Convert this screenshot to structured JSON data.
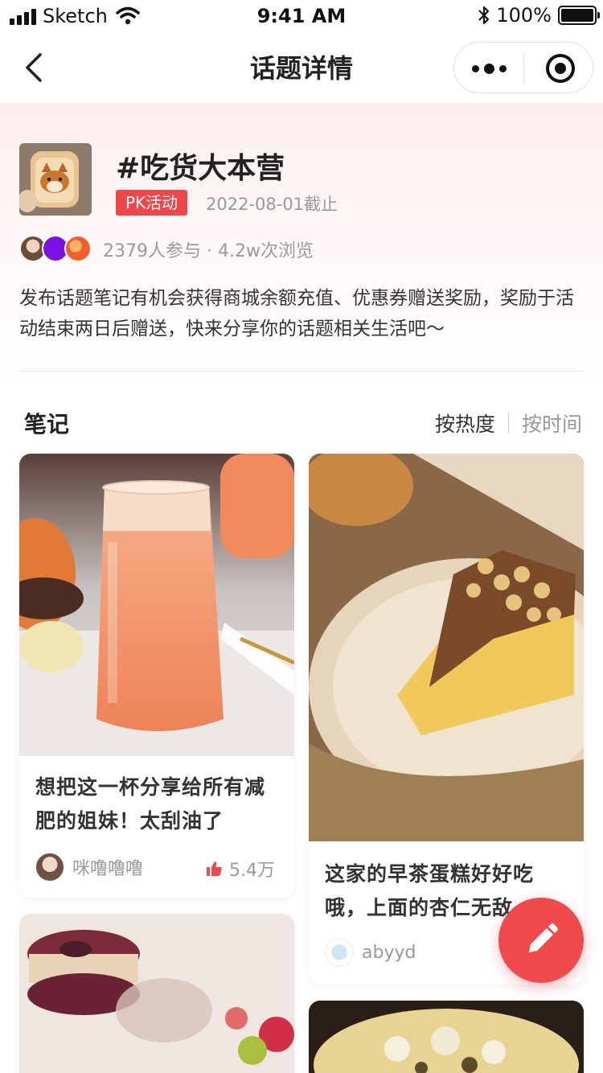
{
  "status_bar": {
    "carrier": "Sketch",
    "time": "9:41 AM",
    "battery": "100%"
  },
  "nav": {
    "title": "话题详情"
  },
  "topic": {
    "title": "#吃货大本营",
    "badge": "PK活动",
    "deadline": "2022-08-01截止",
    "stats": "2379人参与 · 4.2w次浏览",
    "description": "发布话题笔记有机会获得商城余额充值、优惠券赠送奖励，奖励于活动结束两日后赠送，快来分享你的话题相关生活吧～"
  },
  "notes": {
    "title": "笔记",
    "sort_hot": "按热度",
    "sort_time": "按时间"
  },
  "cards": [
    {
      "title": "想把这一杯分享给所有减肥的姐妹！太刮油了",
      "user": "咪噜噜噜",
      "likes": "5.4万"
    },
    {
      "title": "这家的早茶蛋糕好好吃哦，上面的杏仁无敌",
      "user": "abyyd",
      "likes": ""
    }
  ],
  "colors": {
    "accent": "#f04a4d",
    "badge": "#f0474a"
  },
  "icons": [
    "back-icon",
    "more-icon",
    "target-icon",
    "like-icon",
    "edit-icon",
    "wifi-icon",
    "bluetooth-icon"
  ]
}
